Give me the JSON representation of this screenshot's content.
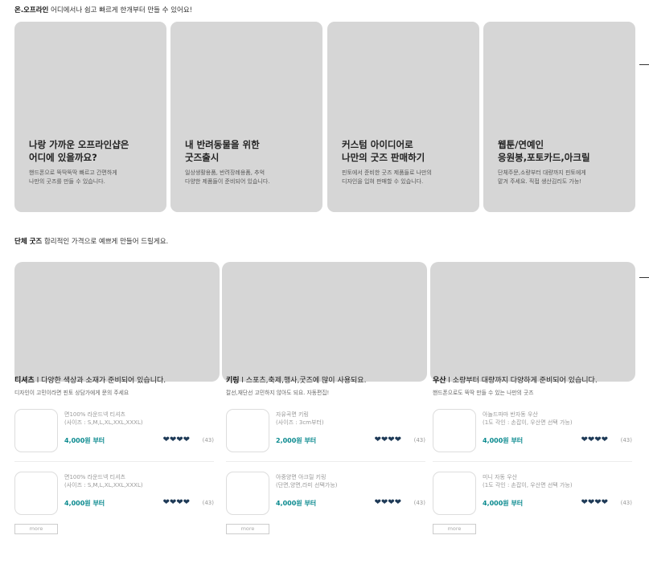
{
  "section1": {
    "title_bold": "온.오프라인",
    "title_rest": " 어디에서나 쉽고 빠르게 한개부터 만들 수 있어요!",
    "cards": [
      {
        "title1": "나랑 가까운 오프라인샵은",
        "title2": "어디에 있을까요?",
        "desc1": "핸드폰으로 뚝딱뚝딱 빠르고 간편하게",
        "desc2": "나만의 굿즈를 만들 수 있습니다."
      },
      {
        "title1": "내 반려동물을 위한",
        "title2": "굿즈출시",
        "desc1": "일상생활용품, 반려장례용품, 추억",
        "desc2": "다양한 제품들이 준비되어 있습니다."
      },
      {
        "title1": "커스텀 아이디어로",
        "title2": "나만의 굿즈 판매하기",
        "desc1": "핀토에서 준비한 굿즈 제품들로 나만의",
        "desc2": "디자인을 입혀 판매할 수 있습니다."
      },
      {
        "title1": "웹툰/연예인",
        "title2": "응원봉,포토카드,아크릴",
        "desc1": "단체주문,소량부터 대량까지 핀토에게",
        "desc2": "맡겨 주세요. 직접 생산김리도 가능!"
      }
    ]
  },
  "section2": {
    "title_bold": "단체 굿즈",
    "title_rest": " 합리적인 가격으로 예쁘게 만들어 드릴게요.",
    "columns": [
      {
        "title_bold": "티셔츠",
        "title_rest": " l 다양한 색상과 소재가 준비되어 있습니다.",
        "subtitle": "디자인이 고민이라면 핀토 상담가에게 문의 주세요",
        "items": [
          {
            "name1": "면100% 라운드넥 티셔츠",
            "name2": "(사이즈 : S,M,L,XL,XXL,XXXL)",
            "price": "4,000원 부터",
            "rating": "(43)"
          },
          {
            "name1": "면100% 라운드넥 티셔츠",
            "name2": "(사이즈 : S,M,L,XL,XXL,XXXL)",
            "price": "4,000원 부터",
            "rating": "(43)"
          }
        ],
        "more": "more"
      },
      {
        "title_bold": "키링",
        "title_rest": " l 스포츠,축제,행사,굿즈에 많이 사용되요.",
        "subtitle": "칼선,재단선 고민하지 않아도 되요. 자동편집!",
        "items": [
          {
            "name1": "자유곡면 키링",
            "name2": "(사이즈 : 3cm부터)",
            "price": "2,000원 부터",
            "rating": "(43)"
          },
          {
            "name1": "아중양면 아크릴 키링",
            "name2": "(단면,양면,라미 선택가능)",
            "price": "4,000원 부터",
            "rating": "(43)"
          }
        ],
        "more": "more"
      },
      {
        "title_bold": "우산",
        "title_rest": " l 소량부터 대량까지 다양하게 준비되어 있습니다.",
        "subtitle": "핸드폰으로도 뚝딱 만들 수 있는 나만의 굿즈",
        "items": [
          {
            "name1": "아놀드파마 반자동 우산",
            "name2": "(1도 각인 : 손잡이, 우산면 선택 가능)",
            "price": "4,000원 부터",
            "rating": "(43)"
          },
          {
            "name1": "미니 자동 우산",
            "name2": "(1도 각인 : 손잡이, 우산면 선택 가능)",
            "price": "4,000원 부터",
            "rating": "(43)"
          }
        ],
        "more": "more"
      }
    ]
  },
  "hearts": "❤❤❤❤",
  "colors": {
    "card_bg": "#d6d6d6",
    "price": "#0b8a8f",
    "heart": "#1e3a57"
  }
}
